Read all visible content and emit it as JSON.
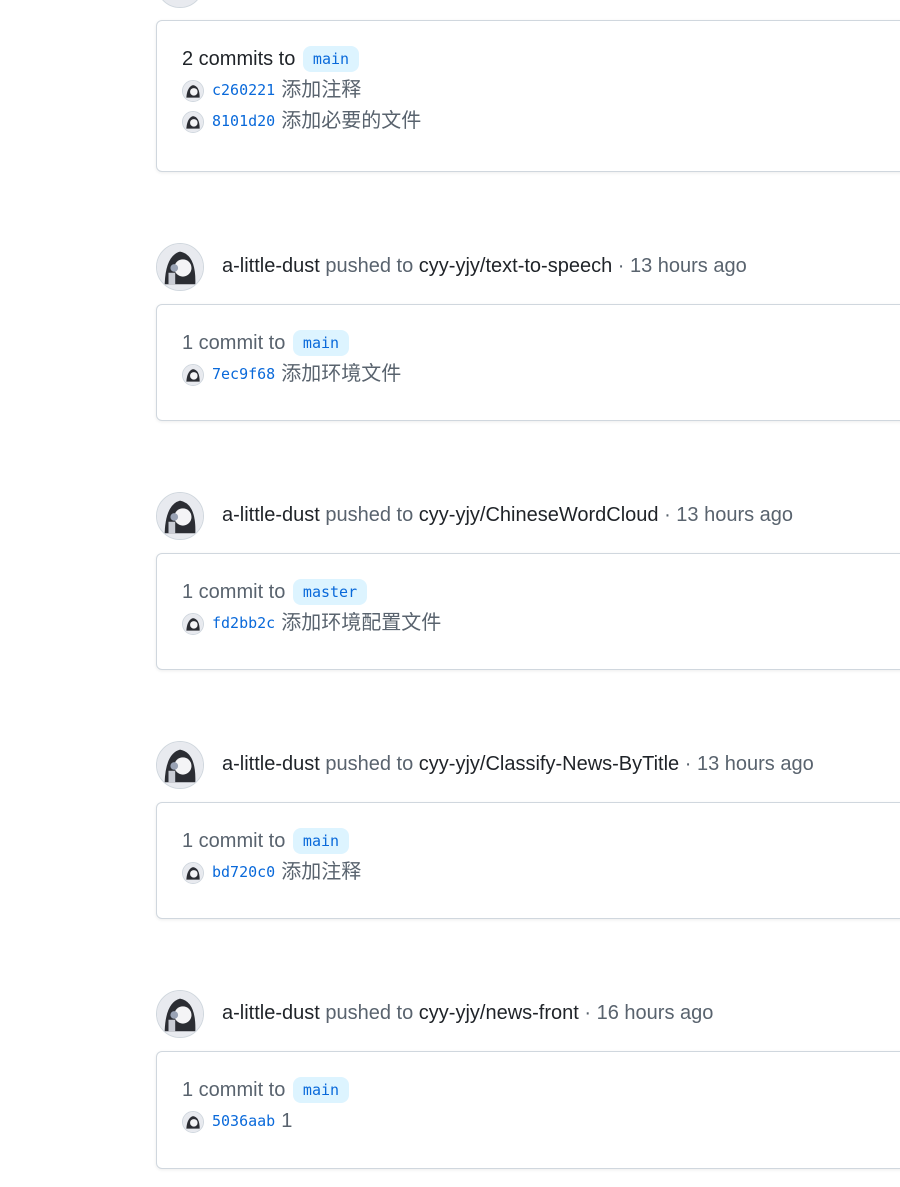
{
  "events": [
    {
      "actor": "",
      "action": "",
      "repo": "",
      "time": "",
      "summary_text": "2 commits to",
      "branch": "main",
      "commits": [
        {
          "sha": "c260221",
          "message": "添加注释"
        },
        {
          "sha": "8101d20",
          "message": "添加必要的文件"
        }
      ]
    },
    {
      "actor": "a-little-dust",
      "action": "pushed to",
      "repo": "cyy-yjy/text-to-speech",
      "time": "· 13 hours ago",
      "summary_text": "1 commit to",
      "branch": "main",
      "commits": [
        {
          "sha": "7ec9f68",
          "message": "添加环境文件"
        }
      ]
    },
    {
      "actor": "a-little-dust",
      "action": "pushed to",
      "repo": "cyy-yjy/ChineseWordCloud",
      "time": "· 13 hours ago",
      "summary_text": "1 commit to",
      "branch": "master",
      "commits": [
        {
          "sha": "fd2bb2c",
          "message": "添加环境配置文件"
        }
      ]
    },
    {
      "actor": "a-little-dust",
      "action": "pushed to",
      "repo": "cyy-yjy/Classify-News-ByTitle",
      "time": "· 13 hours ago",
      "summary_text": "1 commit to",
      "branch": "main",
      "commits": [
        {
          "sha": "bd720c0",
          "message": "添加注释"
        }
      ]
    },
    {
      "actor": "a-little-dust",
      "action": "pushed to",
      "repo": "cyy-yjy/news-front",
      "time": "· 16 hours ago",
      "summary_text": "1 commit to",
      "branch": "main",
      "commits": [
        {
          "sha": "5036aab",
          "message": "1"
        }
      ]
    }
  ],
  "colors": {
    "link": "#0969da",
    "branch_bg": "#ddf4ff",
    "muted": "#59636e",
    "border": "#d0d7de"
  }
}
